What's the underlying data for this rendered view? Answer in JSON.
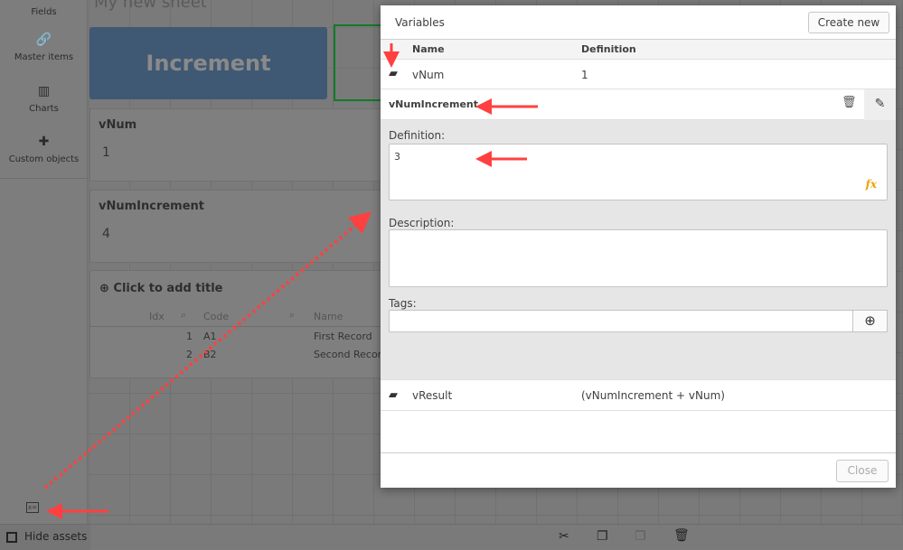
{
  "sidebar": {
    "items": [
      {
        "label": "Fields",
        "icon": "fields-icon"
      },
      {
        "label": "Master items",
        "icon": "link-icon"
      },
      {
        "label": "Charts",
        "icon": "bar-chart-icon"
      },
      {
        "label": "Custom objects",
        "icon": "puzzle-icon"
      }
    ]
  },
  "sheet": {
    "title": "My new sheet",
    "button_label": "Increment",
    "kpis": [
      {
        "title": "vNum",
        "value": "1"
      },
      {
        "title": "vNumIncrement",
        "value": "4"
      }
    ],
    "table": {
      "title": "Click to add title",
      "columns": [
        "Idx",
        "Code",
        "Name"
      ],
      "rows": [
        [
          "1",
          "A1",
          "First Record"
        ],
        [
          "2",
          "B2",
          "Second Record"
        ]
      ]
    }
  },
  "bottombar": {
    "hide_assets": "Hide assets"
  },
  "dialog": {
    "title": "Variables",
    "create_new": "Create new",
    "columns": {
      "name": "Name",
      "definition": "Definition"
    },
    "variables": [
      {
        "name": "vNum",
        "definition": "1"
      },
      {
        "name": "vResult",
        "definition": "(vNumIncrement + vNum)"
      }
    ],
    "selected": {
      "name": "vNumIncrement",
      "definition_label": "Definition:",
      "definition_value": "3",
      "description_label": "Description:",
      "description_value": "",
      "tags_label": "Tags:",
      "tags_value": "",
      "fx": "fx"
    },
    "close": "Close"
  },
  "colors": {
    "button": "#3f5873",
    "selection": "#0f7a2a",
    "arrow": "#ff4040",
    "fx": "#f0a000"
  }
}
